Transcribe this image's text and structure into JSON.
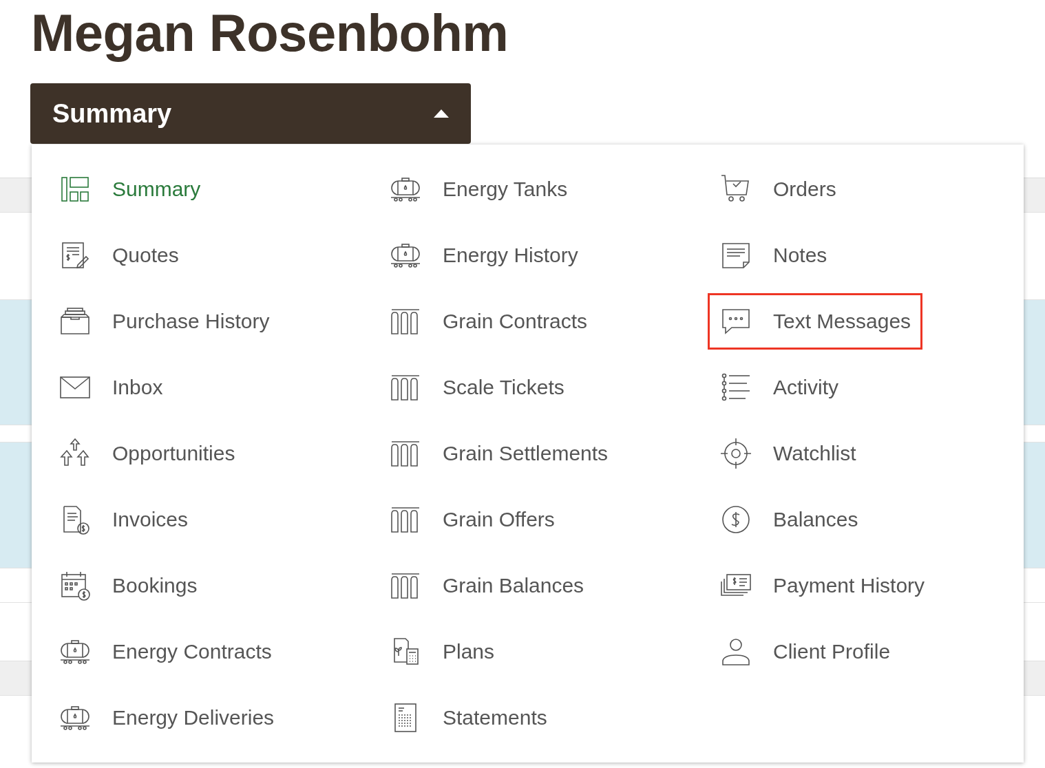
{
  "page_title": "Megan Rosenbohm",
  "section_dropdown": {
    "label": "Summary",
    "expanded": true
  },
  "menu": {
    "columns": [
      {
        "items": [
          {
            "label": "Summary",
            "selected": true,
            "highlighted": false
          },
          {
            "label": "Quotes",
            "selected": false,
            "highlighted": false
          },
          {
            "label": "Purchase History",
            "selected": false,
            "highlighted": false
          },
          {
            "label": "Inbox",
            "selected": false,
            "highlighted": false
          },
          {
            "label": "Opportunities",
            "selected": false,
            "highlighted": false
          },
          {
            "label": "Invoices",
            "selected": false,
            "highlighted": false
          },
          {
            "label": "Bookings",
            "selected": false,
            "highlighted": false
          },
          {
            "label": "Energy Contracts",
            "selected": false,
            "highlighted": false
          },
          {
            "label": "Energy Deliveries",
            "selected": false,
            "highlighted": false
          }
        ]
      },
      {
        "items": [
          {
            "label": "Energy Tanks",
            "selected": false,
            "highlighted": false
          },
          {
            "label": "Energy History",
            "selected": false,
            "highlighted": false
          },
          {
            "label": "Grain Contracts",
            "selected": false,
            "highlighted": false
          },
          {
            "label": "Scale Tickets",
            "selected": false,
            "highlighted": false
          },
          {
            "label": "Grain Settlements",
            "selected": false,
            "highlighted": false
          },
          {
            "label": "Grain Offers",
            "selected": false,
            "highlighted": false
          },
          {
            "label": "Grain Balances",
            "selected": false,
            "highlighted": false
          },
          {
            "label": "Plans",
            "selected": false,
            "highlighted": false
          },
          {
            "label": "Statements",
            "selected": false,
            "highlighted": false
          }
        ]
      },
      {
        "items": [
          {
            "label": "Orders",
            "selected": false,
            "highlighted": false
          },
          {
            "label": "Notes",
            "selected": false,
            "highlighted": false
          },
          {
            "label": "Text Messages",
            "selected": false,
            "highlighted": true
          },
          {
            "label": "Activity",
            "selected": false,
            "highlighted": false
          },
          {
            "label": "Watchlist",
            "selected": false,
            "highlighted": false
          },
          {
            "label": "Balances",
            "selected": false,
            "highlighted": false
          },
          {
            "label": "Payment History",
            "selected": false,
            "highlighted": false
          },
          {
            "label": "Client Profile",
            "selected": false,
            "highlighted": false
          }
        ]
      }
    ]
  }
}
